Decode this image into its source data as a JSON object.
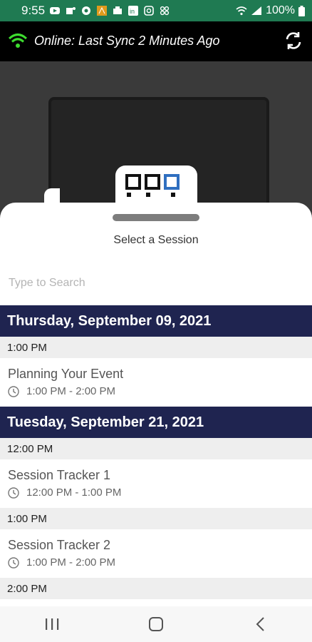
{
  "status_bar": {
    "time": "9:55",
    "battery": "100%",
    "icons": [
      "youtube-icon",
      "teams-icon",
      "chat-icon",
      "app-icon",
      "inbox-icon",
      "linkedin-icon",
      "instagram-icon",
      "slack-icon",
      "wifi-icon",
      "signal-icon",
      "battery-icon"
    ]
  },
  "sync": {
    "text": "Online: Last Sync 2 Minutes Ago",
    "wifi_color": "#3ddc2f"
  },
  "sheet": {
    "title": "Select a Session",
    "search_placeholder": "Type to Search"
  },
  "days": [
    {
      "date": "Thursday, September 09, 2021",
      "slots": [
        {
          "time": "1:00 PM",
          "sessions": [
            {
              "name": "Planning Your Event",
              "range": "1:00 PM - 2:00 PM"
            }
          ]
        }
      ]
    },
    {
      "date": "Tuesday, September 21, 2021",
      "slots": [
        {
          "time": "12:00 PM",
          "sessions": [
            {
              "name": "Session Tracker 1",
              "range": "12:00 PM - 1:00 PM"
            }
          ]
        },
        {
          "time": "1:00 PM",
          "sessions": [
            {
              "name": "Session Tracker 2",
              "range": "1:00 PM - 2:00 PM"
            }
          ]
        },
        {
          "time": "2:00 PM",
          "sessions": []
        }
      ]
    }
  ],
  "colors": {
    "status_bar": "#1f7a52",
    "date_header": "#1f2450",
    "time_header": "#eeeeee"
  }
}
